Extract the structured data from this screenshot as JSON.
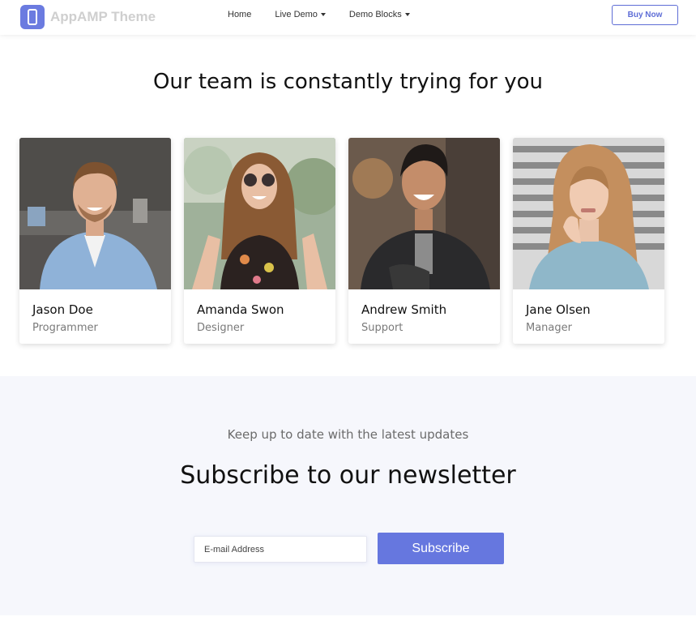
{
  "header": {
    "brand": "AppAMP Theme",
    "brand_icon": "phone-icon",
    "nav": [
      {
        "label": "Home",
        "has_dropdown": false
      },
      {
        "label": "Live Demo",
        "has_dropdown": true
      },
      {
        "label": "Demo Blocks",
        "has_dropdown": true
      }
    ],
    "buy_label": "Buy Now"
  },
  "team": {
    "title": "Our team is constantly trying for you",
    "members": [
      {
        "name": "Jason Doe",
        "role": "Programmer"
      },
      {
        "name": "Amanda Swon",
        "role": "Designer"
      },
      {
        "name": "Andrew Smith",
        "role": "Support"
      },
      {
        "name": "Jane Olsen",
        "role": "Manager"
      }
    ]
  },
  "newsletter": {
    "subtitle": "Keep up to date with the latest updates",
    "title": "Subscribe to our newsletter",
    "email_placeholder": "E-mail Address",
    "email_value": "",
    "button_label": "Subscribe"
  },
  "colors": {
    "accent": "#6677df",
    "newsletter_bg": "#f6f7fc"
  }
}
